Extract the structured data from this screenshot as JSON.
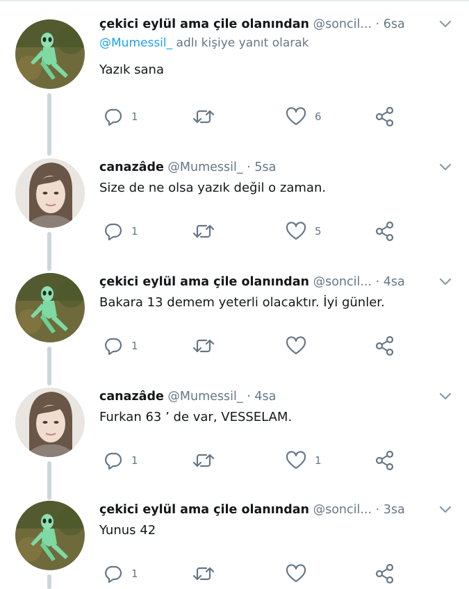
{
  "tweets": [
    {
      "display_name": "çekici eylül ama çile olanından",
      "handle": "@soncil...",
      "dot": "·",
      "time": "6sa",
      "reply_prefix": "@Mumessil_",
      "reply_suffix": " adlı kişiye yanıt olarak",
      "text": "Yazık sana",
      "replies": "1",
      "retweets": "",
      "likes": "6",
      "avatar": "alien-avatar"
    },
    {
      "display_name": "canazâde",
      "handle": "@Mumessil_",
      "dot": "·",
      "time": "5sa",
      "text": "Size de ne olsa yazık değil o zaman.",
      "replies": "1",
      "retweets": "",
      "likes": "5",
      "avatar": "woman-avatar"
    },
    {
      "display_name": "çekici eylül ama çile olanından",
      "handle": "@soncil...",
      "dot": "·",
      "time": "4sa",
      "text": "Bakara 13 demem yeterli olacaktır. İyi günler.",
      "replies": "1",
      "retweets": "",
      "likes": "",
      "avatar": "alien-avatar"
    },
    {
      "display_name": "canazâde",
      "handle": "@Mumessil_",
      "dot": "·",
      "time": "4sa",
      "text": "Furkan 63 ’ de var, VESSELAM.",
      "replies": "1",
      "retweets": "",
      "likes": "1",
      "avatar": "woman-avatar"
    },
    {
      "display_name": "çekici eylül ama çile olanından",
      "handle": "@soncil...",
      "dot": "·",
      "time": "3sa",
      "text": "Yunus 42",
      "replies": "1",
      "retweets": "",
      "likes": "",
      "avatar": "alien-avatar"
    }
  ],
  "icons": {
    "reply": "reply-icon",
    "retweet": "retweet-icon",
    "like": "heart-icon",
    "share": "share-icon",
    "menu": "chevron-down-icon"
  },
  "colors": {
    "text": "#14171a",
    "muted": "#657786",
    "link": "#1da1f2",
    "connector": "#ccd6dd"
  }
}
